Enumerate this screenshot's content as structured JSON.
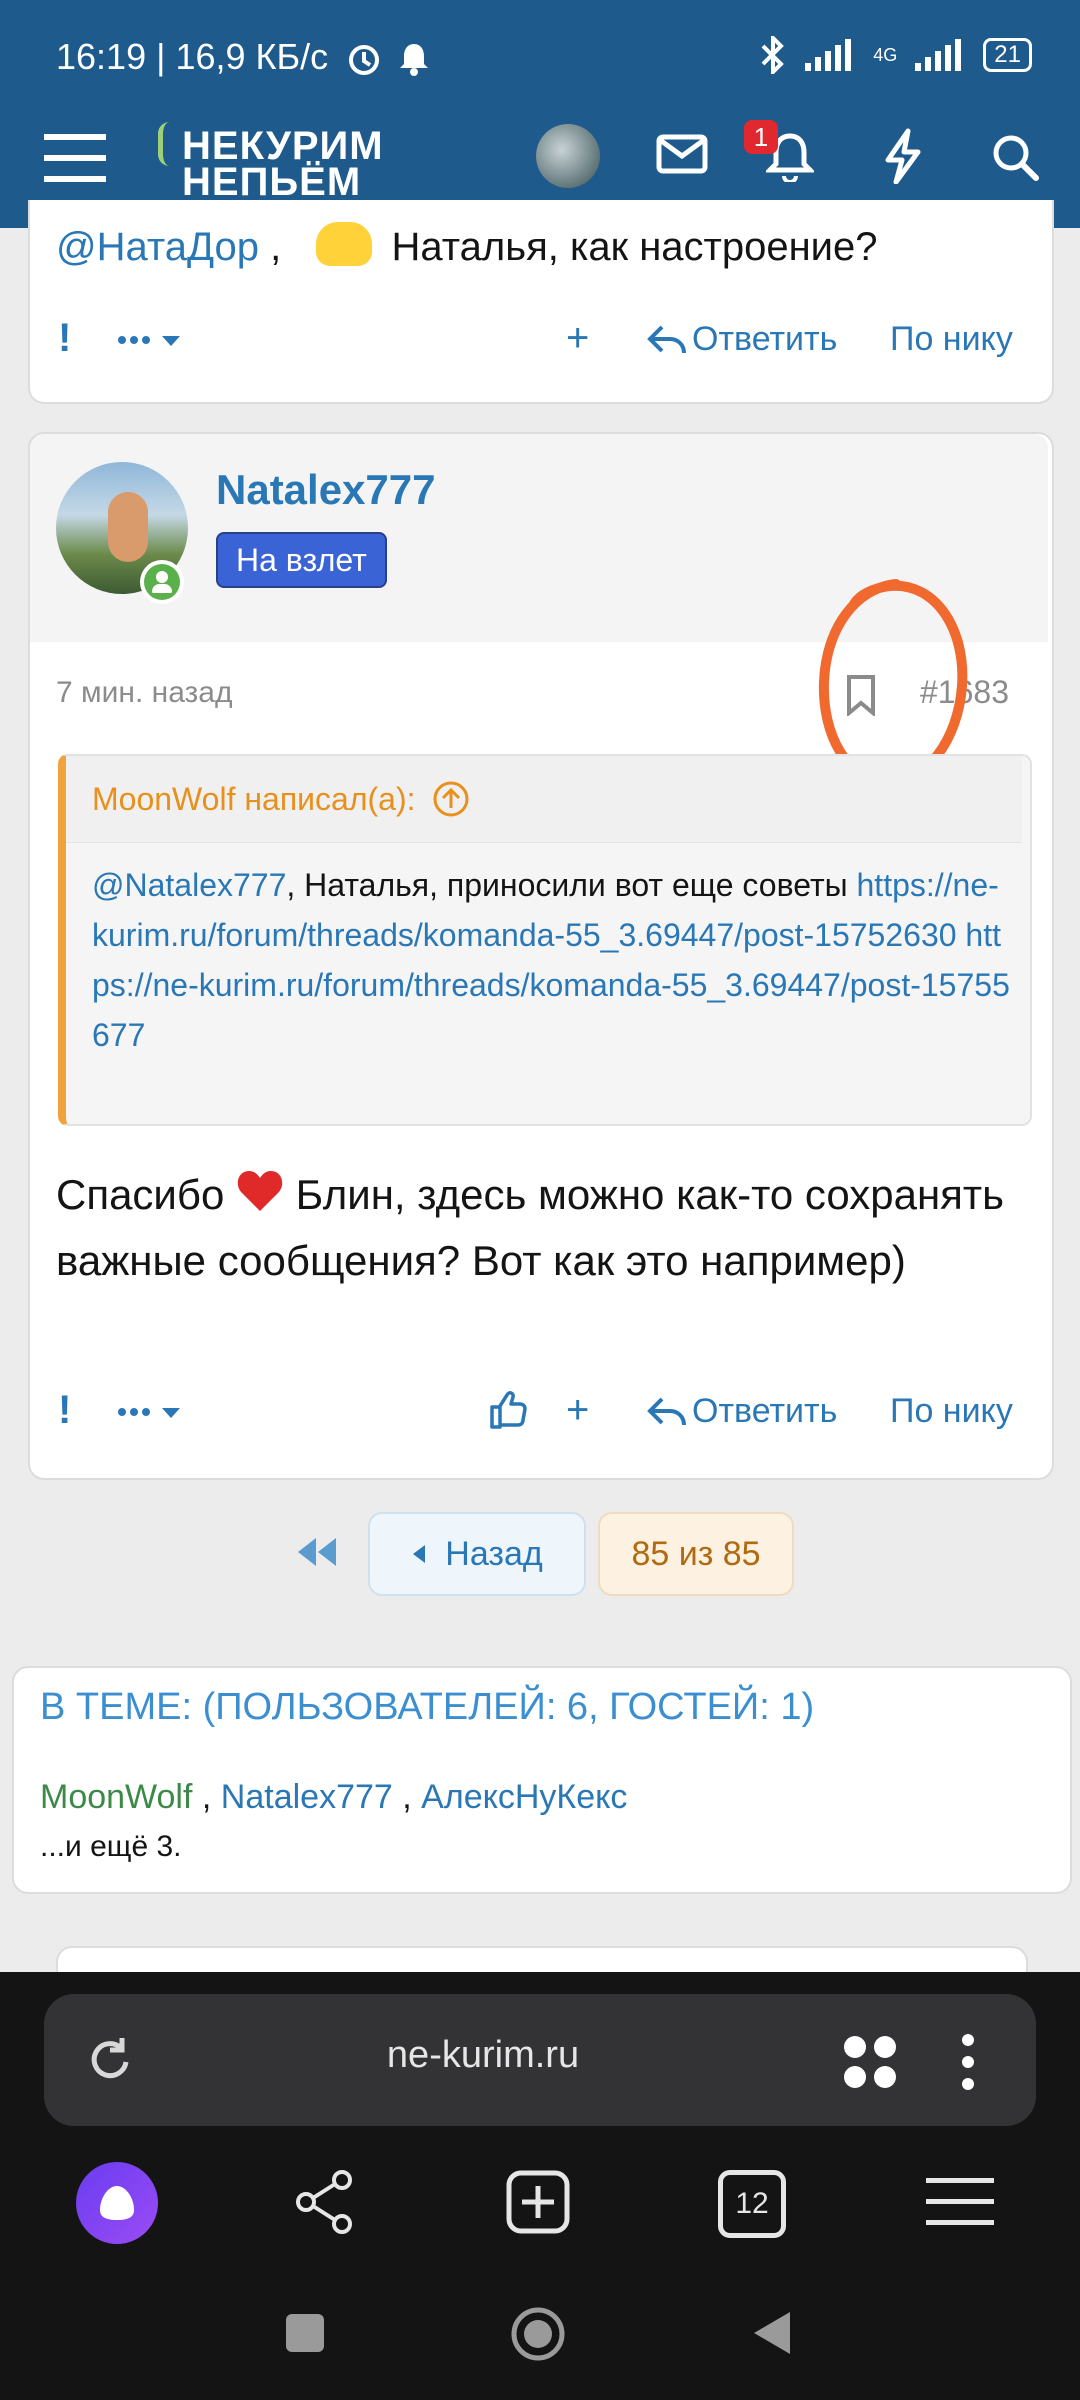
{
  "status": {
    "time_speed": "16:19 | 16,9 КБ/с",
    "network": "4G",
    "battery": "21"
  },
  "header": {
    "logo_line1": "НЕКУРИМ",
    "logo_line2": "НЕПЬЁМ",
    "notification_count": "1"
  },
  "prev_post": {
    "text_mention": "@НатаДор",
    "text_rest": "Наталья, как настроение?",
    "plus": "+",
    "reply": "Ответить",
    "by_nick": "По нику"
  },
  "post": {
    "author": "Natalex777",
    "badge": "На взлет",
    "time": "7 мин. назад",
    "number": "#1683",
    "quote_author": "MoonWolf написал(а):",
    "quote_mention": "@Natalex777",
    "quote_text": ", Наталья, приносили вот еще советы",
    "quote_link1": "https://ne-kurim.ru/forum/threads/komanda-55_3.69447/post-15752630",
    "quote_link2": "https://ne-kurim.ru/forum/threads/komanda-55_3.69447/post-15755677",
    "body_before_heart": "Спасибо",
    "body_after_heart": "Блин, здесь можно как-то сохранять важные сообщения? Вот как это например)",
    "plus": "+",
    "reply": "Ответить",
    "by_nick": "По нику"
  },
  "pagination": {
    "back": "Назад",
    "page": "85 из 85"
  },
  "online": {
    "title": "В ТЕМЕ: (ПОЛЬЗОВАТЕЛЕЙ: 6, ГОСТЕЙ: 1)",
    "users": [
      "MoonWolf",
      "Natalex777",
      "АлексНуКекс"
    ],
    "more": "...и ещё 3."
  },
  "browser": {
    "url": "ne-kurim.ru",
    "tabs_count": "12"
  },
  "colors": {
    "header": "#1f5a8c",
    "link": "#2a77b6",
    "quote_border": "#f2a23a",
    "badge": "#3a63d6",
    "annotation": "#f06a30"
  }
}
